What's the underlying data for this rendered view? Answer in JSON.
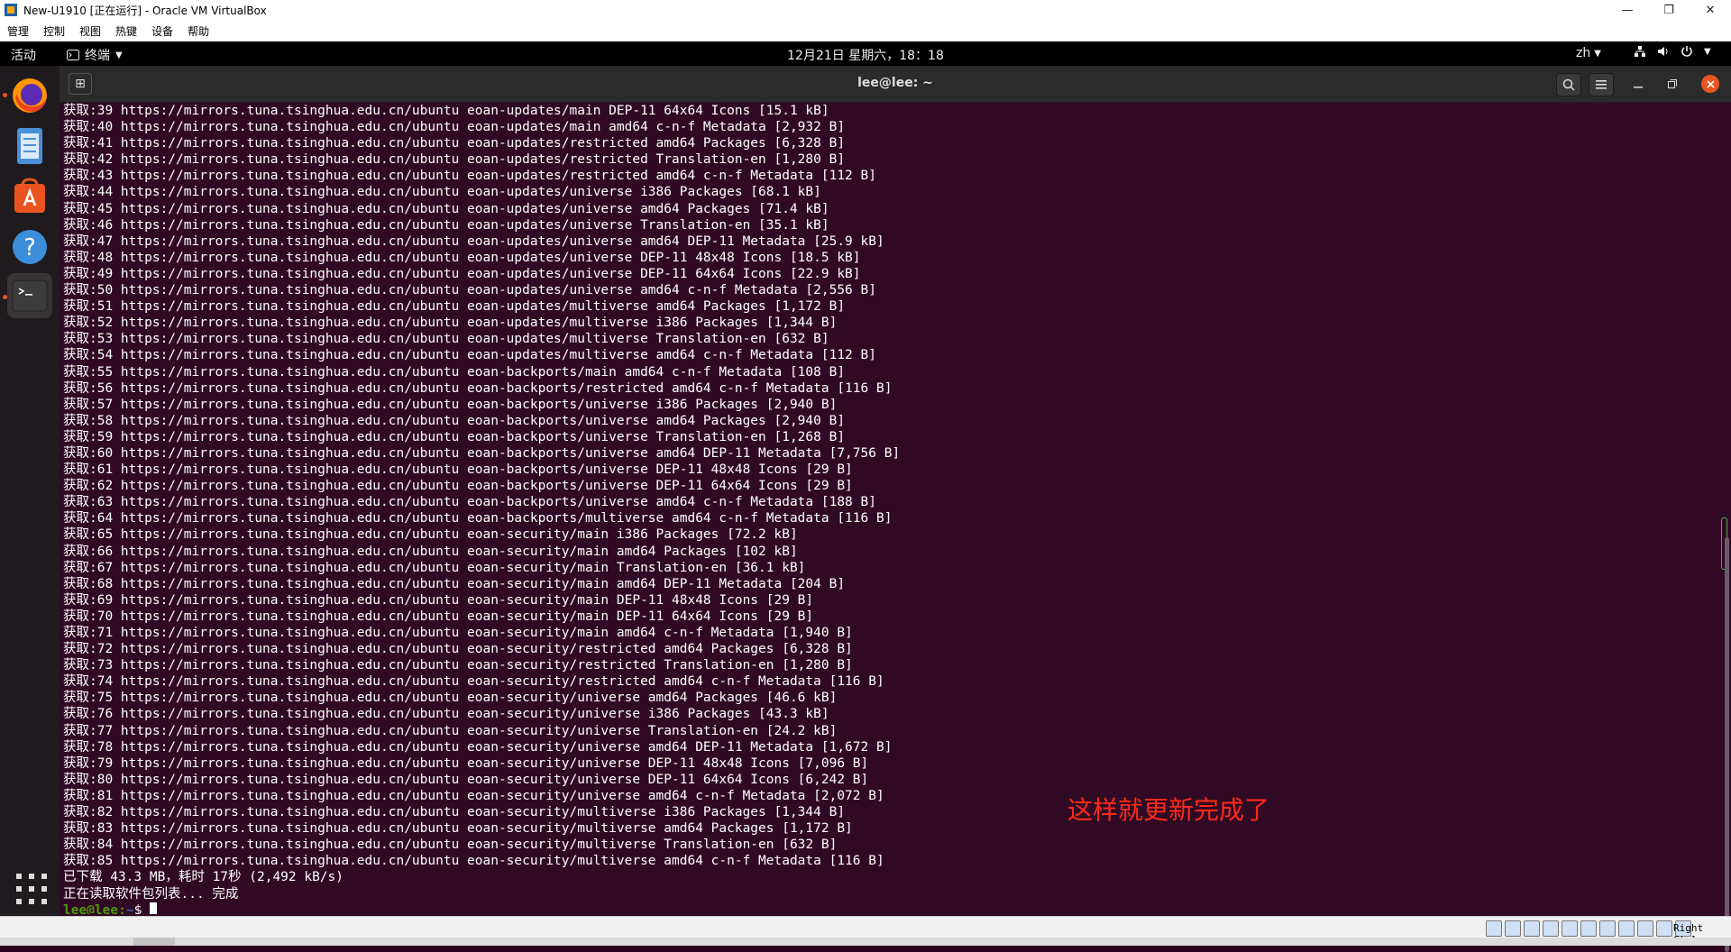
{
  "host_window": {
    "title": "New-U1910 [正在运行] - Oracle VM VirtualBox",
    "minimize_glyph": "—",
    "maximize_glyph": "❐",
    "close_glyph": "✕",
    "menu": [
      "管理",
      "控制",
      "视图",
      "热键",
      "设备",
      "帮助"
    ]
  },
  "topbar": {
    "activities": "活动",
    "app_menu": "终端",
    "clock": "12月21日 星期六，18：18",
    "lang": "zh"
  },
  "dock": {
    "items": [
      "firefox-icon",
      "files-icon",
      "software-icon",
      "help-icon",
      "terminal-icon"
    ]
  },
  "terminal": {
    "title": "lee@lee: ~",
    "lines": [
      "获取:39 https://mirrors.tuna.tsinghua.edu.cn/ubuntu eoan-updates/main DEP-11 64x64 Icons [15.1 kB]",
      "获取:40 https://mirrors.tuna.tsinghua.edu.cn/ubuntu eoan-updates/main amd64 c-n-f Metadata [2,932 B]",
      "获取:41 https://mirrors.tuna.tsinghua.edu.cn/ubuntu eoan-updates/restricted amd64 Packages [6,328 B]",
      "获取:42 https://mirrors.tuna.tsinghua.edu.cn/ubuntu eoan-updates/restricted Translation-en [1,280 B]",
      "获取:43 https://mirrors.tuna.tsinghua.edu.cn/ubuntu eoan-updates/restricted amd64 c-n-f Metadata [112 B]",
      "获取:44 https://mirrors.tuna.tsinghua.edu.cn/ubuntu eoan-updates/universe i386 Packages [68.1 kB]",
      "获取:45 https://mirrors.tuna.tsinghua.edu.cn/ubuntu eoan-updates/universe amd64 Packages [71.4 kB]",
      "获取:46 https://mirrors.tuna.tsinghua.edu.cn/ubuntu eoan-updates/universe Translation-en [35.1 kB]",
      "获取:47 https://mirrors.tuna.tsinghua.edu.cn/ubuntu eoan-updates/universe amd64 DEP-11 Metadata [25.9 kB]",
      "获取:48 https://mirrors.tuna.tsinghua.edu.cn/ubuntu eoan-updates/universe DEP-11 48x48 Icons [18.5 kB]",
      "获取:49 https://mirrors.tuna.tsinghua.edu.cn/ubuntu eoan-updates/universe DEP-11 64x64 Icons [22.9 kB]",
      "获取:50 https://mirrors.tuna.tsinghua.edu.cn/ubuntu eoan-updates/universe amd64 c-n-f Metadata [2,556 B]",
      "获取:51 https://mirrors.tuna.tsinghua.edu.cn/ubuntu eoan-updates/multiverse amd64 Packages [1,172 B]",
      "获取:52 https://mirrors.tuna.tsinghua.edu.cn/ubuntu eoan-updates/multiverse i386 Packages [1,344 B]",
      "获取:53 https://mirrors.tuna.tsinghua.edu.cn/ubuntu eoan-updates/multiverse Translation-en [632 B]",
      "获取:54 https://mirrors.tuna.tsinghua.edu.cn/ubuntu eoan-updates/multiverse amd64 c-n-f Metadata [112 B]",
      "获取:55 https://mirrors.tuna.tsinghua.edu.cn/ubuntu eoan-backports/main amd64 c-n-f Metadata [108 B]",
      "获取:56 https://mirrors.tuna.tsinghua.edu.cn/ubuntu eoan-backports/restricted amd64 c-n-f Metadata [116 B]",
      "获取:57 https://mirrors.tuna.tsinghua.edu.cn/ubuntu eoan-backports/universe i386 Packages [2,940 B]",
      "获取:58 https://mirrors.tuna.tsinghua.edu.cn/ubuntu eoan-backports/universe amd64 Packages [2,940 B]",
      "获取:59 https://mirrors.tuna.tsinghua.edu.cn/ubuntu eoan-backports/universe Translation-en [1,268 B]",
      "获取:60 https://mirrors.tuna.tsinghua.edu.cn/ubuntu eoan-backports/universe amd64 DEP-11 Metadata [7,756 B]",
      "获取:61 https://mirrors.tuna.tsinghua.edu.cn/ubuntu eoan-backports/universe DEP-11 48x48 Icons [29 B]",
      "获取:62 https://mirrors.tuna.tsinghua.edu.cn/ubuntu eoan-backports/universe DEP-11 64x64 Icons [29 B]",
      "获取:63 https://mirrors.tuna.tsinghua.edu.cn/ubuntu eoan-backports/universe amd64 c-n-f Metadata [188 B]",
      "获取:64 https://mirrors.tuna.tsinghua.edu.cn/ubuntu eoan-backports/multiverse amd64 c-n-f Metadata [116 B]",
      "获取:65 https://mirrors.tuna.tsinghua.edu.cn/ubuntu eoan-security/main i386 Packages [72.2 kB]",
      "获取:66 https://mirrors.tuna.tsinghua.edu.cn/ubuntu eoan-security/main amd64 Packages [102 kB]",
      "获取:67 https://mirrors.tuna.tsinghua.edu.cn/ubuntu eoan-security/main Translation-en [36.1 kB]",
      "获取:68 https://mirrors.tuna.tsinghua.edu.cn/ubuntu eoan-security/main amd64 DEP-11 Metadata [204 B]",
      "获取:69 https://mirrors.tuna.tsinghua.edu.cn/ubuntu eoan-security/main DEP-11 48x48 Icons [29 B]",
      "获取:70 https://mirrors.tuna.tsinghua.edu.cn/ubuntu eoan-security/main DEP-11 64x64 Icons [29 B]",
      "获取:71 https://mirrors.tuna.tsinghua.edu.cn/ubuntu eoan-security/main amd64 c-n-f Metadata [1,940 B]",
      "获取:72 https://mirrors.tuna.tsinghua.edu.cn/ubuntu eoan-security/restricted amd64 Packages [6,328 B]",
      "获取:73 https://mirrors.tuna.tsinghua.edu.cn/ubuntu eoan-security/restricted Translation-en [1,280 B]",
      "获取:74 https://mirrors.tuna.tsinghua.edu.cn/ubuntu eoan-security/restricted amd64 c-n-f Metadata [116 B]",
      "获取:75 https://mirrors.tuna.tsinghua.edu.cn/ubuntu eoan-security/universe amd64 Packages [46.6 kB]",
      "获取:76 https://mirrors.tuna.tsinghua.edu.cn/ubuntu eoan-security/universe i386 Packages [43.3 kB]",
      "获取:77 https://mirrors.tuna.tsinghua.edu.cn/ubuntu eoan-security/universe Translation-en [24.2 kB]",
      "获取:78 https://mirrors.tuna.tsinghua.edu.cn/ubuntu eoan-security/universe amd64 DEP-11 Metadata [1,672 B]",
      "获取:79 https://mirrors.tuna.tsinghua.edu.cn/ubuntu eoan-security/universe DEP-11 48x48 Icons [7,096 B]",
      "获取:80 https://mirrors.tuna.tsinghua.edu.cn/ubuntu eoan-security/universe DEP-11 64x64 Icons [6,242 B]",
      "获取:81 https://mirrors.tuna.tsinghua.edu.cn/ubuntu eoan-security/universe amd64 c-n-f Metadata [2,072 B]",
      "获取:82 https://mirrors.tuna.tsinghua.edu.cn/ubuntu eoan-security/multiverse i386 Packages [1,344 B]",
      "获取:83 https://mirrors.tuna.tsinghua.edu.cn/ubuntu eoan-security/multiverse amd64 Packages [1,172 B]",
      "获取:84 https://mirrors.tuna.tsinghua.edu.cn/ubuntu eoan-security/multiverse Translation-en [632 B]",
      "获取:85 https://mirrors.tuna.tsinghua.edu.cn/ubuntu eoan-security/multiverse amd64 c-n-f Metadata [116 B]",
      "已下载 43.3 MB，耗时 17秒 (2,492 kB/s)",
      "正在读取软件包列表... 完成"
    ],
    "prompt_user": "lee@lee",
    "prompt_sep": ":",
    "prompt_path": "~",
    "prompt_symbol": "$ "
  },
  "annotation": "这样就更新完成了",
  "vbox_status": {
    "host_key": "Right Ctrl"
  },
  "colors": {
    "terminal_bg": "#300a24",
    "accent": "#e95420",
    "annotation": "#ff2a1a"
  }
}
